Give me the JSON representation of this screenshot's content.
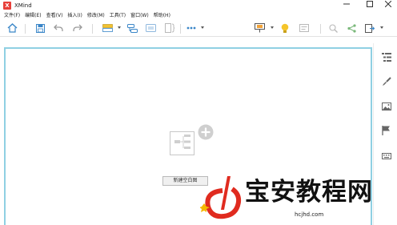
{
  "window": {
    "app_name": "XMind",
    "logo_letter": "X"
  },
  "menubar": {
    "items": [
      {
        "label": "文件(F)"
      },
      {
        "label": "编辑(E)"
      },
      {
        "label": "查看(V)"
      },
      {
        "label": "插入(I)"
      },
      {
        "label": "修改(M)"
      },
      {
        "label": "工具(T)"
      },
      {
        "label": "窗口(W)"
      },
      {
        "label": "帮助(H)"
      }
    ]
  },
  "toolbar": {
    "icons": [
      "home-icon",
      "save-icon",
      "undo-icon",
      "redo-icon",
      "topic-style-icon",
      "link-topic-icon",
      "insert-topic-icon",
      "summary-icon",
      "more-icon",
      "presentation-icon",
      "idea-icon",
      "notes-icon",
      "search-icon",
      "share-icon",
      "export-icon"
    ]
  },
  "sidebar": {
    "icons": [
      "outline-icon",
      "format-brush-icon",
      "image-icon",
      "flag-icon",
      "keyboard-icon"
    ]
  },
  "canvas": {
    "new_blank_label": "新建空白图"
  },
  "watermark": {
    "brand_text": "宝安教程网",
    "url_text": "hcjhd.com"
  },
  "colors": {
    "accent_blue": "#4a90d9",
    "canvas_border": "#8fd0e3",
    "logo_red": "#e8403a",
    "watermark_red": "#e02b1f",
    "watermark_gold": "#f5b800"
  }
}
